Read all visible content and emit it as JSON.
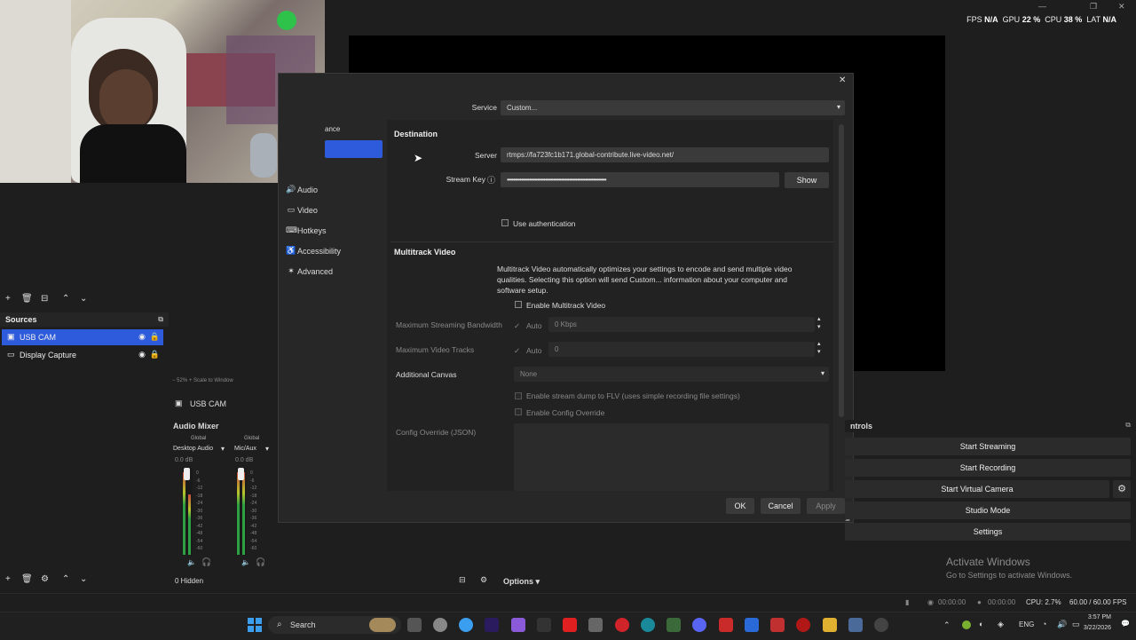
{
  "stats": {
    "fps_label": "FPS",
    "fps_value": "N/A",
    "gpu_label": "GPU",
    "gpu_value": "22 %",
    "cpu_label": "CPU",
    "cpu_value": "38 %",
    "lat_label": "LAT",
    "lat_value": "N/A"
  },
  "sources": {
    "title": "Sources",
    "items": [
      {
        "label": "USB CAM"
      },
      {
        "label": "Display Capture"
      }
    ]
  },
  "preview": {
    "zoom": "52%",
    "scale_label": "Scale to Window",
    "source_name": "USB CAM"
  },
  "mixer": {
    "title": "Audio Mixer",
    "channels": [
      {
        "global": "Global",
        "name": "Desktop Audio",
        "db": "0.0 dB"
      },
      {
        "global": "Global",
        "name": "Mic/Aux",
        "db": "0.0 dB"
      }
    ],
    "scale": [
      "0",
      "-6",
      "-12",
      "-18",
      "-24",
      "-30",
      "-36",
      "-42",
      "-48",
      "-54",
      "-60"
    ],
    "hidden": "0 Hidden",
    "options": "Options"
  },
  "dialog": {
    "nav": [
      {
        "label": "ance"
      },
      {
        "label": "Audio"
      },
      {
        "label": "Video"
      },
      {
        "label": "Hotkeys"
      },
      {
        "label": "Accessibility"
      },
      {
        "label": "Advanced"
      }
    ],
    "service_label": "Service",
    "service_value": "Custom...",
    "destination_title": "Destination",
    "server_label": "Server",
    "server_value": "rtmps://fa723fc1b171.global-contribute.live-video.net/",
    "stream_key_label": "Stream Key",
    "stream_key_value": "••••••••••••••••••••••••••••••••••••••••••••••••••••••••••••••",
    "show_button": "Show",
    "use_auth": "Use authentication",
    "multitrack_title": "Multitrack Video",
    "multitrack_desc": "Multitrack Video automatically optimizes your settings to encode and send multiple video qualities. Selecting this option will send Custom... information about your computer and software setup.",
    "enable_multitrack": "Enable Multitrack Video",
    "max_bw_label": "Maximum Streaming Bandwidth",
    "max_bw_auto": "Auto",
    "max_bw_value": "0 Kbps",
    "max_tracks_label": "Maximum Video Tracks",
    "max_tracks_auto": "Auto",
    "max_tracks_value": "0",
    "additional_canvas_label": "Additional Canvas",
    "additional_canvas_value": "None",
    "stream_dump": "Enable stream dump to FLV (uses simple recording file settings)",
    "enable_config": "Enable Config Override",
    "config_label": "Config Override (JSON)",
    "ok": "OK",
    "cancel": "Cancel",
    "apply": "Apply"
  },
  "controls": {
    "title": "ntrols",
    "buttons": [
      "Start Streaming",
      "Start Recording",
      "Start Virtual Camera",
      "Studio Mode",
      "Settings"
    ]
  },
  "activate": {
    "title": "Activate Windows",
    "subtitle": "Go to Settings to activate Windows."
  },
  "statusbar": {
    "time1": "00:00:00",
    "time2": "00:00:00",
    "cpu": "CPU: 2.7%",
    "fps": "60.00 / 60.00 FPS"
  },
  "taskbar": {
    "search": "Search",
    "lang": "ENG",
    "time": "3:57 PM",
    "date": "3/22/2026"
  },
  "colors": {
    "accent": "#2e5bdc"
  }
}
